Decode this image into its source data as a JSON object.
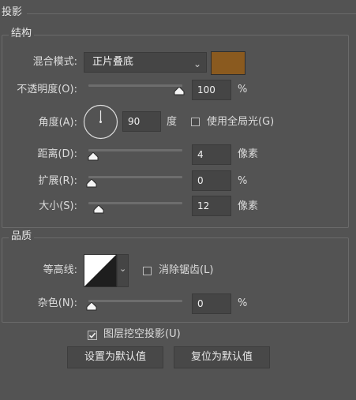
{
  "panel": {
    "title": "投影"
  },
  "structure": {
    "legend": "结构",
    "blend_mode": {
      "label": "混合模式:",
      "value": "正片叠底",
      "swatch_color": "#8a5a1f"
    },
    "opacity": {
      "label": "不透明度(O):",
      "value": "100",
      "unit": "%",
      "level": 1.0
    },
    "angle": {
      "label": "角度(A):",
      "value": "90",
      "unit": "度",
      "global_light_label": "使用全局光(G)",
      "global_light_checked": false
    },
    "distance": {
      "label": "距离(D):",
      "value": "4",
      "unit": "像素",
      "level": 0.02
    },
    "spread": {
      "label": "扩展(R):",
      "value": "0",
      "unit": "%",
      "level": 0.0
    },
    "size": {
      "label": "大小(S):",
      "value": "12",
      "unit": "像素",
      "level": 0.08
    }
  },
  "quality": {
    "legend": "品质",
    "contour": {
      "label": "等高线:"
    },
    "anti_alias": {
      "label": "消除锯齿(L)",
      "checked": false
    },
    "noise": {
      "label": "杂色(N):",
      "value": "0",
      "unit": "%",
      "level": 0.0
    }
  },
  "knockout": {
    "label": "图层挖空投影(U)",
    "checked": true
  },
  "buttons": {
    "make_default": "设置为默认值",
    "reset_default": "复位为默认值"
  }
}
